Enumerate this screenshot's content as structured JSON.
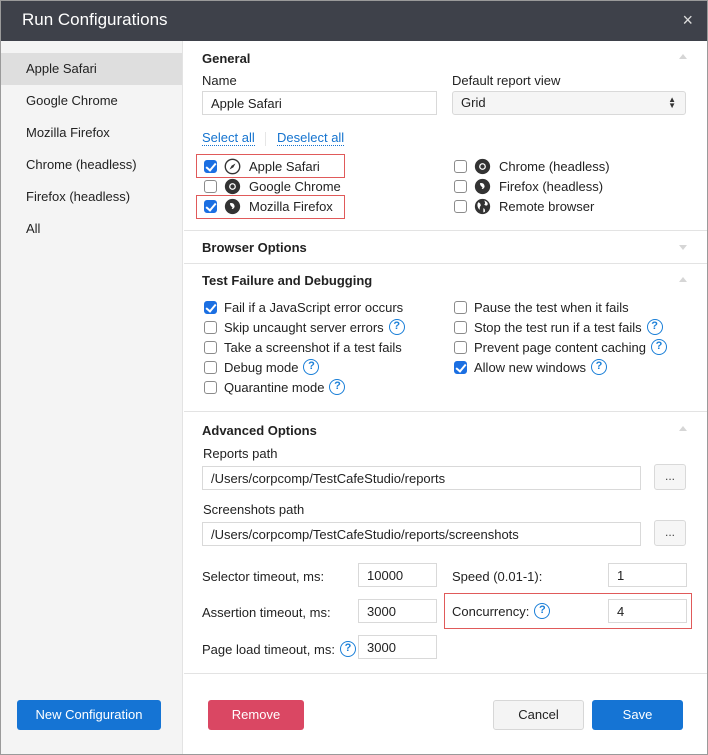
{
  "window": {
    "title": "Run Configurations",
    "close_label": "×"
  },
  "sidebar": {
    "items": [
      {
        "label": "Apple Safari",
        "active": true
      },
      {
        "label": "Google Chrome"
      },
      {
        "label": "Mozilla Firefox"
      },
      {
        "label": "Chrome (headless)"
      },
      {
        "label": "Firefox (headless)"
      },
      {
        "label": "All"
      }
    ],
    "new_configuration_label": "New Configuration"
  },
  "general": {
    "title": "General",
    "name_label": "Name",
    "name_value": "Apple Safari",
    "report_view_label": "Default report view",
    "report_view_value": "Grid",
    "select_all": "Select all",
    "deselect_all": "Deselect all",
    "browsers": [
      {
        "label": "Apple Safari",
        "icon": "safari-icon",
        "checked": true
      },
      {
        "label": "Google Chrome",
        "icon": "chrome-icon",
        "checked": false
      },
      {
        "label": "Mozilla Firefox",
        "icon": "firefox-icon",
        "checked": true
      },
      {
        "label": "Chrome (headless)",
        "icon": "chrome-icon",
        "checked": false
      },
      {
        "label": "Firefox (headless)",
        "icon": "firefox-icon",
        "checked": false
      },
      {
        "label": "Remote browser",
        "icon": "globe-icon",
        "checked": false
      }
    ]
  },
  "browser_options": {
    "title": "Browser Options"
  },
  "debugging": {
    "title": "Test Failure and Debugging",
    "options": [
      {
        "label": "Fail if a JavaScript error occurs",
        "checked": true,
        "help": false
      },
      {
        "label": "Skip uncaught server errors",
        "checked": false,
        "help": true
      },
      {
        "label": "Take a screenshot if a test fails",
        "checked": false,
        "help": false
      },
      {
        "label": "Debug mode",
        "checked": false,
        "help": true
      },
      {
        "label": "Quarantine mode",
        "checked": false,
        "help": true
      },
      {
        "label": "Pause the test when it fails",
        "checked": false,
        "help": false
      },
      {
        "label": "Stop the test run if a test fails",
        "checked": false,
        "help": true
      },
      {
        "label": "Prevent page content caching",
        "checked": false,
        "help": true
      },
      {
        "label": "Allow new windows",
        "checked": true,
        "help": true
      }
    ]
  },
  "advanced": {
    "title": "Advanced Options",
    "reports_path_label": "Reports path",
    "reports_path_value": "/Users/corpcomp/TestCafeStudio/reports",
    "screenshots_path_label": "Screenshots path",
    "screenshots_path_value": "/Users/corpcomp/TestCafeStudio/reports/screenshots",
    "browse_label": "...",
    "selector_timeout_label": "Selector timeout, ms:",
    "selector_timeout_value": "10000",
    "assertion_timeout_label": "Assertion timeout, ms:",
    "assertion_timeout_value": "3000",
    "page_load_timeout_label": "Page load timeout, ms:",
    "page_load_timeout_value": "3000",
    "speed_label": "Speed (0.01-1):",
    "speed_value": "1",
    "concurrency_label": "Concurrency:",
    "concurrency_value": "4"
  },
  "footer": {
    "remove_label": "Remove",
    "cancel_label": "Cancel",
    "save_label": "Save"
  },
  "help_glyph": "?",
  "colors": {
    "titlebar": "#3e414a",
    "primary": "#1574d4",
    "danger": "#da4763",
    "checkbox": "#1b6fe2",
    "highlight_box": "#e05a5a",
    "link": "#1473cf"
  }
}
